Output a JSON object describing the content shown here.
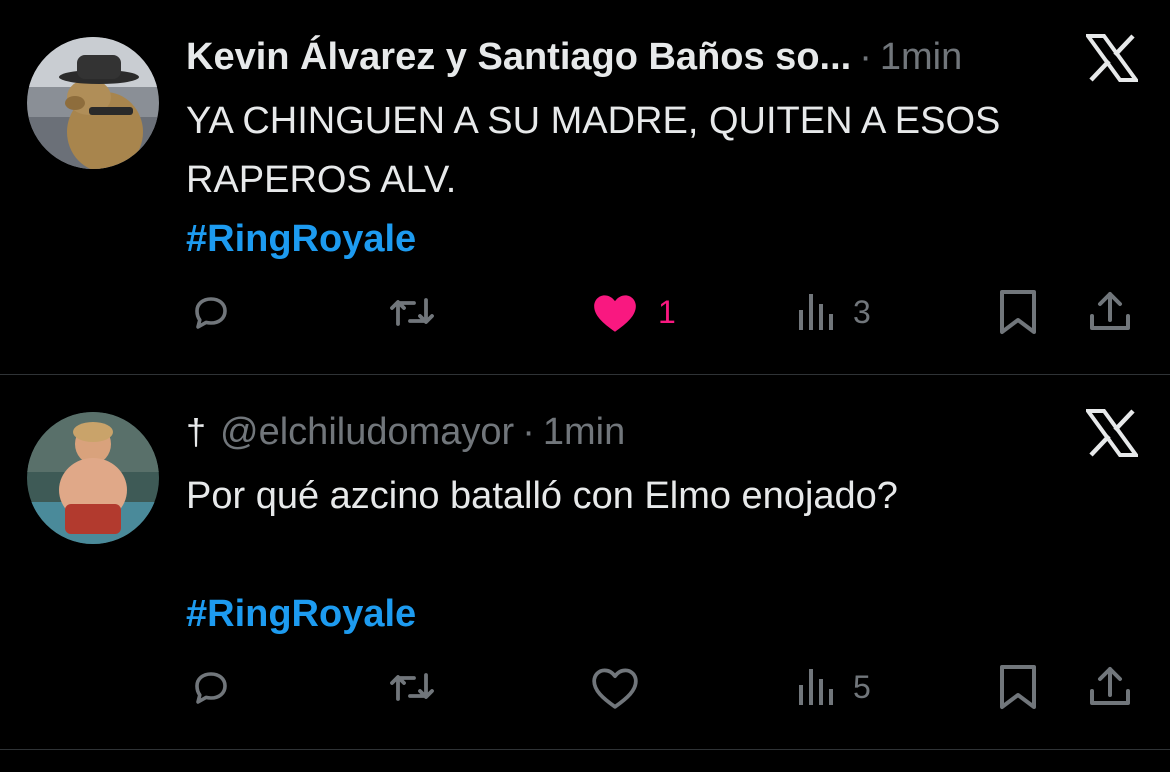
{
  "tweets": [
    {
      "author_name": "Kevin Álvarez y Santiago Baños so...",
      "time": "1min",
      "text_lines": [
        "YA CHINGUEN A SU MADRE, QUITEN A ESOS",
        "RAPEROS ALV."
      ],
      "hashtag": "#RingRoyale",
      "likes": "1",
      "views": "3",
      "liked": true
    },
    {
      "author_prefix": "†",
      "author_handle": "@elchiludomayor",
      "time": "1min",
      "text_lines": [
        "Por qué azcino batalló con Elmo enojado?"
      ],
      "hashtag": "#RingRoyale",
      "likes": "",
      "views": "5",
      "liked": false
    }
  ],
  "separator": "·",
  "colors": {
    "background": "#000000",
    "text": "#e7e9ea",
    "muted": "#71767b",
    "hashtag": "#1d9bf0",
    "like_active": "#f91880",
    "divider": "#2f3336"
  },
  "icons": [
    "reply-icon",
    "retweet-icon",
    "heart-icon",
    "views-icon",
    "bookmark-icon",
    "share-icon",
    "x-logo-icon"
  ]
}
